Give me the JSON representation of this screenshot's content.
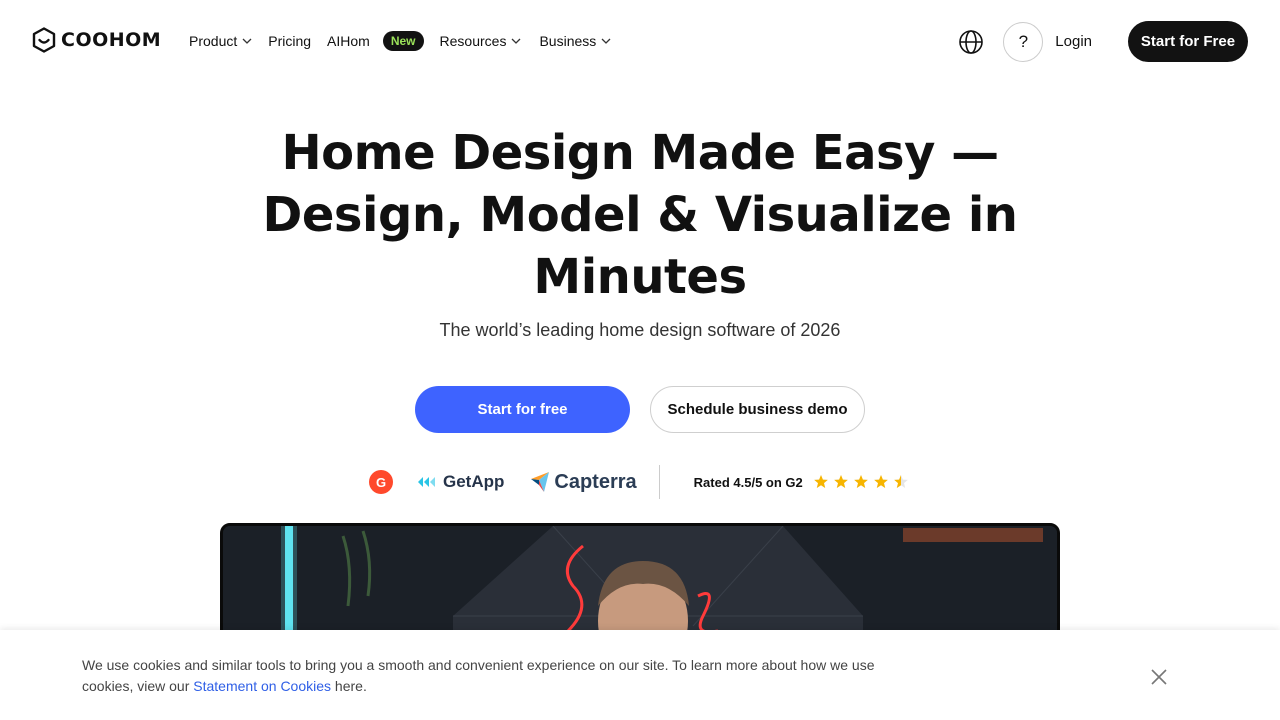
{
  "nav": {
    "logo_text": "COOHOM",
    "menu": {
      "product": "Product",
      "pricing": "Pricing",
      "aihom": "AIHom",
      "aihom_badge": "New",
      "resources": "Resources",
      "business": "Business"
    },
    "help_label": "?",
    "login_label": "Login",
    "cta_label": "Start for Free"
  },
  "hero": {
    "title_line1": "Home Design Made Easy —",
    "title_line2": "Design, Model & Visualize in",
    "title_line3": "Minutes",
    "subtitle": "The world’s leading home design software of 2026",
    "primary_cta": "Start for free",
    "secondary_cta": "Schedule business demo"
  },
  "ratings": {
    "g2_mark": "G",
    "getapp": "GetApp",
    "capterra": "Capterra",
    "rated_text": "Rated 4.5/5 on G2",
    "stars": 4.5,
    "star_color": "#f7b500"
  },
  "cookie": {
    "text_before": "We use cookies and similar tools to bring you a smooth and convenient experience on our site. To learn more about how we use cookies, view our ",
    "link_text": "Statement on Cookies",
    "text_after": " here."
  },
  "colors": {
    "accent_blue": "#3e63ff",
    "dark": "#121212",
    "badge_green": "#9be25a"
  },
  "icons": [
    "coohom-logo-icon",
    "chevron-down-icon",
    "globe-icon",
    "help-icon",
    "g2-logo-icon",
    "getapp-logo-icon",
    "capterra-logo-icon",
    "star-icon",
    "close-icon"
  ]
}
